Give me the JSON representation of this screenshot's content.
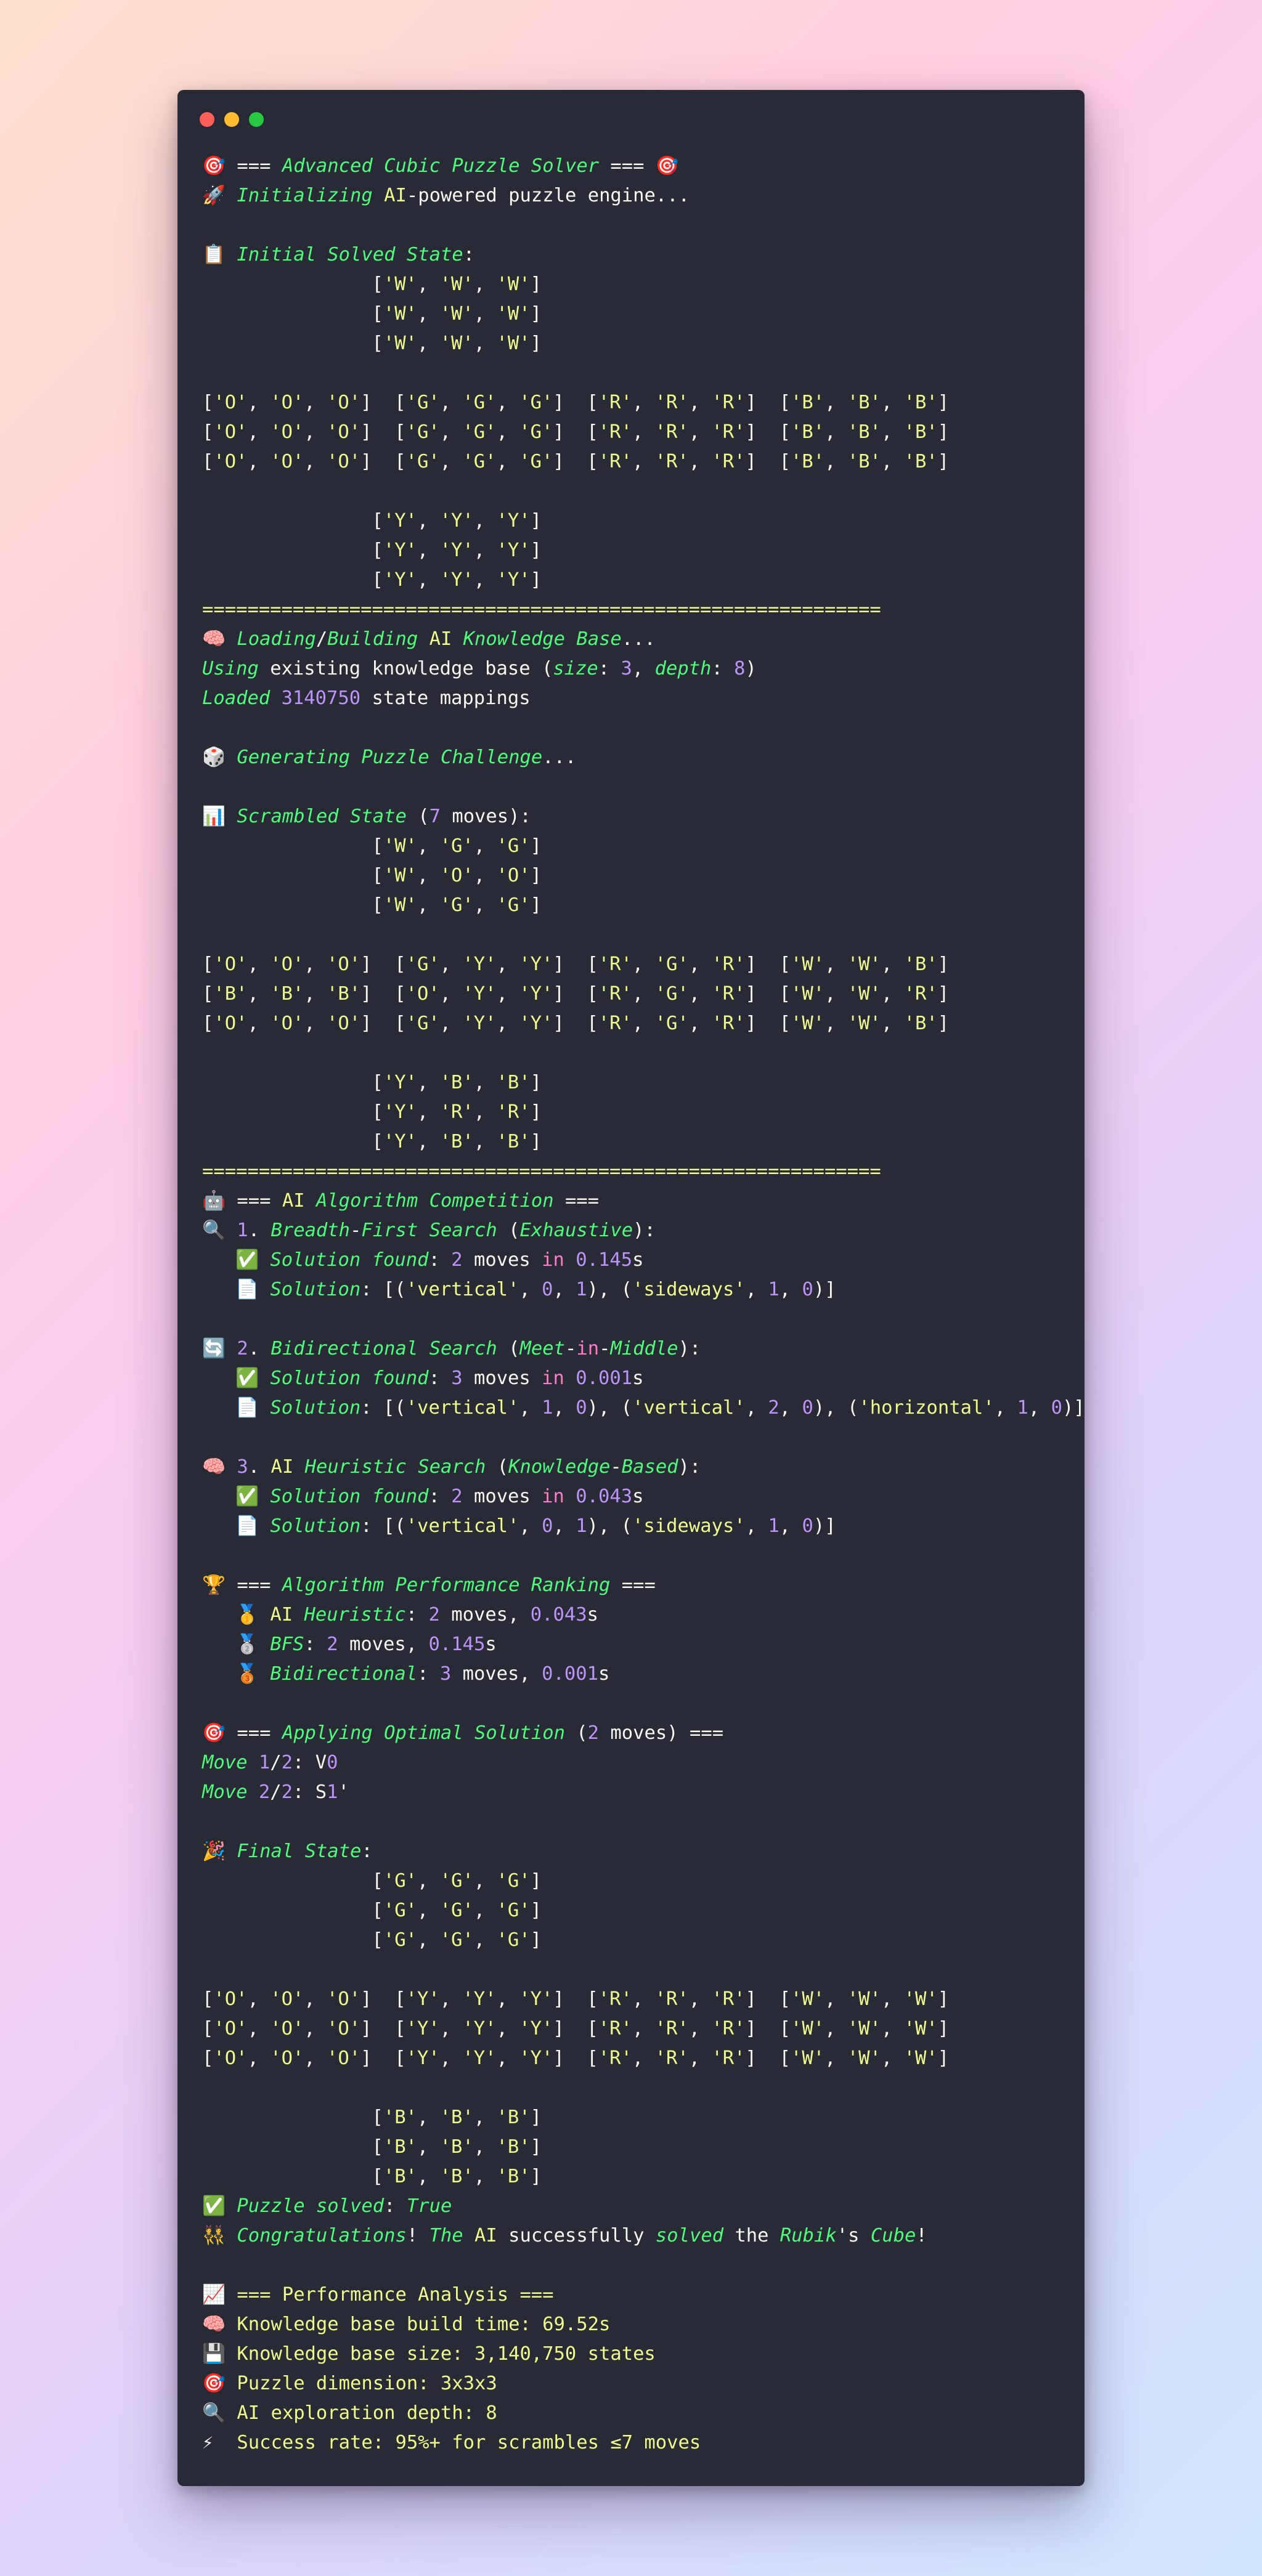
{
  "window": {
    "traffic_lights": [
      "#ff5f57",
      "#febc2e",
      "#28c840"
    ]
  },
  "header": {
    "title": "=== Advanced Cubic Puzzle Solver ===",
    "init": "Initializing AI-powered puzzle engine..."
  },
  "initial": {
    "label": "Initial Solved State:",
    "top": [
      "['W', 'W', 'W']",
      "['W', 'W', 'W']",
      "['W', 'W', 'W']"
    ],
    "middle": [
      "['O', 'O', 'O']  ['G', 'G', 'G']  ['R', 'R', 'R']  ['B', 'B', 'B']",
      "['O', 'O', 'O']  ['G', 'G', 'G']  ['R', 'R', 'R']  ['B', 'B', 'B']",
      "['O', 'O', 'O']  ['G', 'G', 'G']  ['R', 'R', 'R']  ['B', 'B', 'B']"
    ],
    "bottom": [
      "['Y', 'Y', 'Y']",
      "['Y', 'Y', 'Y']",
      "['Y', 'Y', 'Y']"
    ]
  },
  "separator": "============================================================",
  "kb": {
    "loading": "Loading/Building AI Knowledge Base...",
    "using": "Using existing knowledge base (size: 3, depth: 8)",
    "loaded": "Loaded 3140750 state mappings"
  },
  "generate": "Generating Puzzle Challenge...",
  "scrambled": {
    "label": "Scrambled State (7 moves):",
    "top": [
      "['W', 'G', 'G']",
      "['W', 'O', 'O']",
      "['W', 'G', 'G']"
    ],
    "middle": [
      "['O', 'O', 'O']  ['G', 'Y', 'Y']  ['R', 'G', 'R']  ['W', 'W', 'B']",
      "['B', 'B', 'B']  ['O', 'Y', 'Y']  ['R', 'G', 'R']  ['W', 'W', 'R']",
      "['O', 'O', 'O']  ['G', 'Y', 'Y']  ['R', 'G', 'R']  ['W', 'W', 'B']"
    ],
    "bottom": [
      "['Y', 'B', 'B']",
      "['Y', 'R', 'R']",
      "['Y', 'B', 'B']"
    ]
  },
  "competition": {
    "title": "=== AI Algorithm Competition ===",
    "algorithms": [
      {
        "heading": "1. Breadth-First Search (Exhaustive):",
        "found": "Solution found: 2 moves in 0.145s",
        "solution": "Solution: [('vertical', 0, 1), ('sideways', 1, 0)]"
      },
      {
        "heading": "2. Bidirectional Search (Meet-in-Middle):",
        "found": "Solution found: 3 moves in 0.001s",
        "solution": "Solution: [('vertical', 1, 0), ('vertical', 2, 0), ('horizontal', 1, 0)]"
      },
      {
        "heading": "3. AI Heuristic Search (Knowledge-Based):",
        "found": "Solution found: 2 moves in 0.043s",
        "solution": "Solution: [('vertical', 0, 1), ('sideways', 1, 0)]"
      }
    ]
  },
  "ranking": {
    "title": "=== Algorithm Performance Ranking ===",
    "items": [
      "AI Heuristic: 2 moves, 0.043s",
      "BFS: 2 moves, 0.145s",
      "Bidirectional: 3 moves, 0.001s"
    ]
  },
  "apply": {
    "title": "=== Applying Optimal Solution (2 moves) ===",
    "moves": [
      "Move 1/2: V0",
      "Move 2/2: S1'"
    ]
  },
  "final": {
    "label": "Final State:",
    "top": [
      "['G', 'G', 'G']",
      "['G', 'G', 'G']",
      "['G', 'G', 'G']"
    ],
    "middle": [
      "['O', 'O', 'O']  ['Y', 'Y', 'Y']  ['R', 'R', 'R']  ['W', 'W', 'W']",
      "['O', 'O', 'O']  ['Y', 'Y', 'Y']  ['R', 'R', 'R']  ['W', 'W', 'W']",
      "['O', 'O', 'O']  ['Y', 'Y', 'Y']  ['R', 'R', 'R']  ['W', 'W', 'W']"
    ],
    "bottom": [
      "['B', 'B', 'B']",
      "['B', 'B', 'B']",
      "['B', 'B', 'B']"
    ],
    "solved": "Puzzle solved: True",
    "congrats": "Congratulations! The AI successfully solved the Rubik's Cube!"
  },
  "performance": {
    "title": "=== Performance Analysis ===",
    "items": [
      "Knowledge base build time: 69.52s",
      "Knowledge base size: 3,140,750 states",
      "Puzzle dimension: 3x3x3",
      "AI exploration depth: 8",
      "Success rate: 95%+ for scrambles ≤7 moves"
    ]
  },
  "icons": {
    "target": "🎯",
    "rocket": "🚀",
    "clipboard": "📋",
    "brain": "🧠",
    "dice": "🎲",
    "chart": "📊",
    "robot": "🤖",
    "search": "🔍",
    "check": "✅",
    "page": "📄",
    "repeat": "🔄",
    "trophy": "🏆",
    "gold": "🥇",
    "silver": "🥈",
    "bronze": "🥉",
    "party": "🎉",
    "dancers": "👯",
    "trend": "📈",
    "floppy": "💾",
    "bolt": "⚡"
  }
}
